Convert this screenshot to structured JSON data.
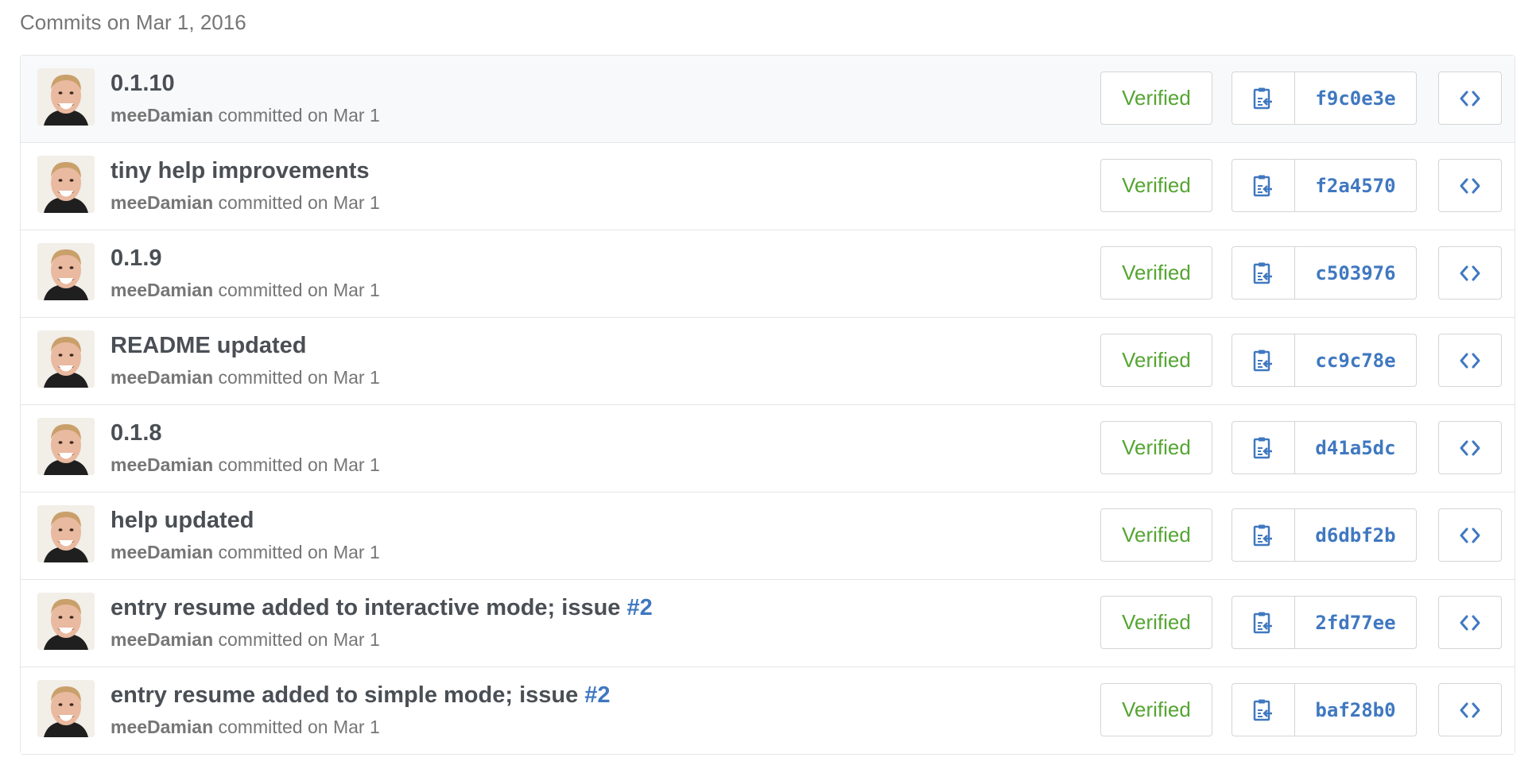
{
  "group_title": "Commits on Mar 1, 2016",
  "colors": {
    "verified": "#55a532",
    "link": "#4078c0",
    "muted": "#767676",
    "title": "#4a4f55"
  },
  "icons": {
    "copy": "clipboard-copy-icon",
    "browse": "code-brackets-icon"
  },
  "commits": [
    {
      "message": "0.1.10",
      "issue": "",
      "author": "meeDamian",
      "meta": "committed on Mar 1",
      "verified": "Verified",
      "sha": "f9c0e3e",
      "browse": "<>"
    },
    {
      "message": "tiny help improvements",
      "issue": "",
      "author": "meeDamian",
      "meta": "committed on Mar 1",
      "verified": "Verified",
      "sha": "f2a4570",
      "browse": "<>"
    },
    {
      "message": "0.1.9",
      "issue": "",
      "author": "meeDamian",
      "meta": "committed on Mar 1",
      "verified": "Verified",
      "sha": "c503976",
      "browse": "<>"
    },
    {
      "message": "README updated",
      "issue": "",
      "author": "meeDamian",
      "meta": "committed on Mar 1",
      "verified": "Verified",
      "sha": "cc9c78e",
      "browse": "<>"
    },
    {
      "message": "0.1.8",
      "issue": "",
      "author": "meeDamian",
      "meta": "committed on Mar 1",
      "verified": "Verified",
      "sha": "d41a5dc",
      "browse": "<>"
    },
    {
      "message": "help updated",
      "issue": "",
      "author": "meeDamian",
      "meta": "committed on Mar 1",
      "verified": "Verified",
      "sha": "d6dbf2b",
      "browse": "<>"
    },
    {
      "message": "entry resume added to interactive mode; issue ",
      "issue": "#2",
      "author": "meeDamian",
      "meta": "committed on Mar 1",
      "verified": "Verified",
      "sha": "2fd77ee",
      "browse": "<>"
    },
    {
      "message": "entry resume added to simple mode; issue ",
      "issue": "#2",
      "author": "meeDamian",
      "meta": "committed on Mar 1",
      "verified": "Verified",
      "sha": "baf28b0",
      "browse": "<>"
    }
  ]
}
